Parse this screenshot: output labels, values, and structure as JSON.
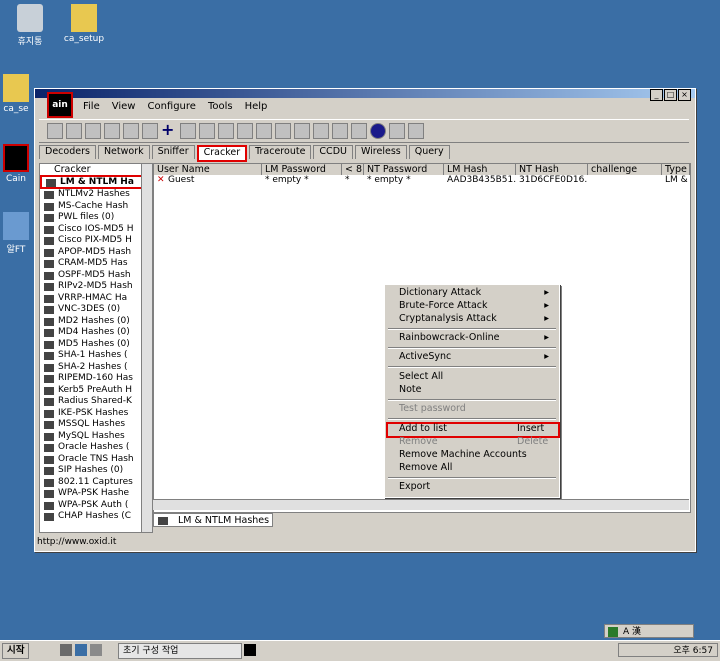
{
  "desktop": {
    "icons": [
      {
        "label": "휴지통"
      },
      {
        "label": "ca_setup"
      },
      {
        "label": "ca_se"
      },
      {
        "label": "Cain"
      },
      {
        "label": "알FT"
      }
    ]
  },
  "window": {
    "logo_text": "ain",
    "menu": [
      "File",
      "View",
      "Configure",
      "Tools",
      "Help"
    ],
    "tabs": [
      {
        "label": "Decoders"
      },
      {
        "label": "Network"
      },
      {
        "label": "Sniffer"
      },
      {
        "label": "Cracker",
        "active": true
      },
      {
        "label": "Traceroute"
      },
      {
        "label": "CCDU"
      },
      {
        "label": "Wireless"
      },
      {
        "label": "Query"
      }
    ],
    "tree_root": "Cracker",
    "tree_items": [
      "LM & NTLM Ha",
      "NTLMv2 Hashes",
      "MS-Cache Hash",
      "PWL files (0)",
      "Cisco IOS-MD5 H",
      "Cisco PIX-MD5 H",
      "APOP-MD5 Hash",
      "CRAM-MD5 Has",
      "OSPF-MD5 Hash",
      "RIPv2-MD5 Hash",
      "VRRP-HMAC Ha",
      "VNC-3DES (0)",
      "MD2 Hashes (0)",
      "MD4 Hashes (0)",
      "MD5 Hashes (0)",
      "SHA-1 Hashes (",
      "SHA-2 Hashes (",
      "RIPEMD-160 Has",
      "Kerb5 PreAuth H",
      "Radius Shared-K",
      "IKE-PSK Hashes",
      "MSSQL Hashes",
      "MySQL Hashes",
      "Oracle Hashes (",
      "Oracle TNS Hash",
      "SIP Hashes (0)",
      "802.11 Captures",
      "WPA-PSK Hashe",
      "WPA-PSK Auth (",
      "CHAP Hashes (C"
    ],
    "columns": [
      "User Name",
      "LM Password",
      "< 8",
      "NT Password",
      "LM Hash",
      "NT Hash",
      "challenge",
      "Type"
    ],
    "rows": [
      {
        "user": "Guest",
        "lm_password": "* empty *",
        "lt8": "*",
        "nt_password": "* empty *",
        "lm_hash": "AAD3B435B51...",
        "nt_hash": "31D6CFE0D16...",
        "challenge": "",
        "type": "LM &"
      }
    ],
    "bottom_tab": "LM & NTLM Hashes",
    "status": "http://www.oxid.it"
  },
  "context_menu": {
    "items": [
      {
        "label": "Dictionary Attack",
        "submenu": "▸"
      },
      {
        "label": "Brute-Force Attack",
        "submenu": "▸"
      },
      {
        "label": "Cryptanalysis Attack",
        "submenu": "▸"
      },
      {
        "label": "Rainbowcrack-Online",
        "submenu": "▸"
      },
      {
        "label": "ActiveSync",
        "submenu": "▸"
      },
      {
        "label": "Select All"
      },
      {
        "label": "Note"
      },
      {
        "label": "Test password"
      },
      {
        "label": "Add to list",
        "key": "Insert"
      },
      {
        "label": "Remove",
        "key": "Delete"
      },
      {
        "label": "Remove Machine Accounts"
      },
      {
        "label": "Remove All"
      },
      {
        "label": "Export"
      }
    ]
  },
  "taskbar": {
    "start": "시작",
    "task": "초기 구성 작업",
    "time": "오후 6:57",
    "ime": "A 漢"
  }
}
